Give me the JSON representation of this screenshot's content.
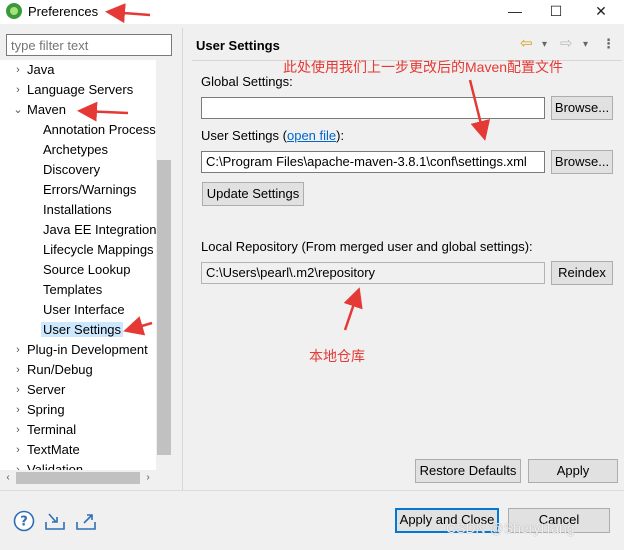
{
  "window": {
    "title": "Preferences",
    "icons": {
      "app": "eclipse-icon",
      "minimize": "minimize-icon",
      "maximize": "maximize-icon",
      "close": "close-icon"
    },
    "minimize_glyph": "—",
    "maximize_glyph": "☐",
    "close_glyph": "✕"
  },
  "sidebar": {
    "filter_placeholder": "type filter text",
    "items": [
      {
        "label": "Java",
        "twisty": "›"
      },
      {
        "label": "Language Servers",
        "twisty": "›"
      },
      {
        "label": "Maven",
        "twisty": "⌄"
      },
      {
        "label": "Annotation Processing"
      },
      {
        "label": "Archetypes"
      },
      {
        "label": "Discovery"
      },
      {
        "label": "Errors/Warnings"
      },
      {
        "label": "Installations"
      },
      {
        "label": "Java EE Integration"
      },
      {
        "label": "Lifecycle Mappings"
      },
      {
        "label": "Source Lookup"
      },
      {
        "label": "Templates"
      },
      {
        "label": "User Interface"
      },
      {
        "label": "User Settings",
        "selected": true
      },
      {
        "label": "Plug-in Development",
        "twisty": "›"
      },
      {
        "label": "Run/Debug",
        "twisty": "›"
      },
      {
        "label": "Server",
        "twisty": "›"
      },
      {
        "label": "Spring",
        "twisty": "›"
      },
      {
        "label": "Terminal",
        "twisty": "›"
      },
      {
        "label": "TextMate",
        "twisty": "›"
      },
      {
        "label": "Validation",
        "twisty": "›"
      }
    ],
    "scroll_left_glyph": "‹",
    "scroll_right_glyph": "›"
  },
  "main": {
    "title": "User Settings",
    "nav": {
      "back": "⇦",
      "back_dd": "▾",
      "forward": "⇨",
      "forward_dd": "▾",
      "menu": "⋮"
    },
    "global_settings_label": "Global Settings:",
    "global_settings_value": "",
    "browse_label": "Browse...",
    "user_settings_prefix": "User Settings (",
    "open_file_link": "open file",
    "user_settings_suffix": "):",
    "user_settings_value": "C:\\Program Files\\apache-maven-3.8.1\\conf\\settings.xml",
    "update_settings_label": "Update Settings",
    "local_repo_label": "Local Repository (From merged user and global settings):",
    "local_repo_value": "C:\\Users\\pearl\\.m2\\repository",
    "reindex_label": "Reindex",
    "restore_defaults_label": "Restore Defaults",
    "apply_label": "Apply"
  },
  "footer": {
    "apply_close_label": "Apply and Close",
    "cancel_label": "Cancel",
    "icons": [
      "help-icon",
      "import-icon",
      "export-icon"
    ]
  },
  "annotations": {
    "top_note": "此处使用我们上一步更改后的Maven配置文件",
    "local_repo_note": "本地仓库",
    "watermark": "CSDN @SheryITang",
    "color": "#e53935"
  }
}
